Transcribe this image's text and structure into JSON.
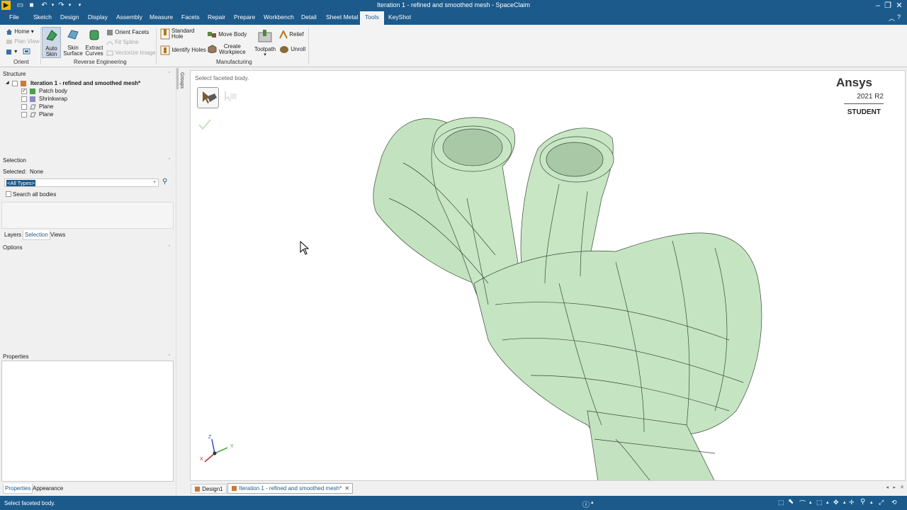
{
  "window": {
    "title": "Iteration 1 - refined and smoothed mesh - SpaceClaim"
  },
  "menu": {
    "tabs": [
      "File",
      "Sketch",
      "Design",
      "Display",
      "Assembly",
      "Measure",
      "Facets",
      "Repair",
      "Prepare",
      "Workbench",
      "Detail",
      "Sheet Metal",
      "Tools",
      "KeyShot"
    ],
    "active": "Tools"
  },
  "ribbon": {
    "orient": {
      "home": "Home",
      "plan_view": "Plan View",
      "group_label": "Orient"
    },
    "reverse_engineering": {
      "auto_skin_1": "Auto",
      "auto_skin_2": "Skin",
      "skin_surface_1": "Skin",
      "skin_surface_2": "Surface",
      "extract_curves_1": "Extract",
      "extract_curves_2": "Curves",
      "orient_facets": "Orient Facets",
      "fit_spline": "Fit Spline",
      "vectorize_image": "Vectorize Image",
      "group_label": "Reverse Engineering"
    },
    "manufacturing": {
      "standard_hole_1": "Standard",
      "standard_hole_2": "Hole",
      "identify_holes": "Identify Holes",
      "move_body": "Move Body",
      "create_workpiece_1": "Create",
      "create_workpiece_2": "Workpiece",
      "toolpath": "Toolpath",
      "relief": "Relief",
      "unroll": "Unroll",
      "group_label": "Manufacturing"
    }
  },
  "structure": {
    "header": "Structure",
    "root": "Iteration 1 - refined and smoothed mesh*",
    "items": [
      "Patch body",
      "Shrinkwrap",
      "Plane",
      "Plane"
    ]
  },
  "side_tab": "Groups",
  "selection": {
    "header": "Selection",
    "selected_label": "Selected:",
    "selected_value": "None",
    "filter_value": "<All Types>",
    "search_all": "Search all bodies"
  },
  "panel_tabs": [
    "Layers",
    "Selection",
    "Views"
  ],
  "options": {
    "header": "Options"
  },
  "properties": {
    "header": "Properties"
  },
  "bottom_tabs": [
    "Properties",
    "Appearance"
  ],
  "viewport": {
    "prompt": "Select faceted body.",
    "brand": "Ansys",
    "version": "2021 R2",
    "edition": "STUDENT",
    "axes": {
      "x": "X",
      "y": "Y",
      "z": "Z"
    }
  },
  "document_tabs": [
    "Design1",
    "Iteration 1 - refined and smoothed mesh*"
  ],
  "status": {
    "message": "Select faceted body."
  },
  "colors": {
    "chrome_blue": "#1c5a8c",
    "mesh_green": "#c8e6c4",
    "active_tab_text": "#1c5a8c"
  }
}
